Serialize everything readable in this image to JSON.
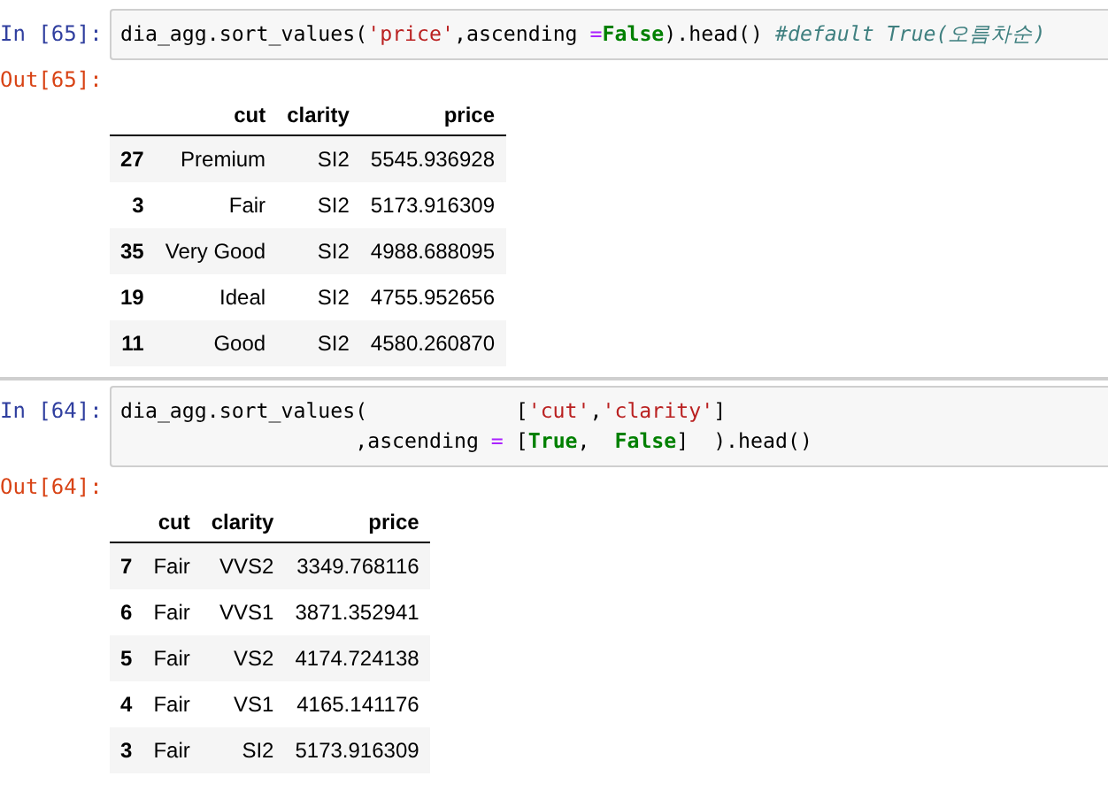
{
  "cells": [
    {
      "in_prompt": "In [65]:",
      "code": [
        [
          {
            "kind": "plain",
            "text": "dia_agg.sort_values("
          },
          {
            "kind": "string",
            "text": "'price'"
          },
          {
            "kind": "plain",
            "text": ",ascending "
          },
          {
            "kind": "operator",
            "text": "="
          },
          {
            "kind": "keyword",
            "text": "False"
          },
          {
            "kind": "plain",
            "text": ").head() "
          },
          {
            "kind": "comment",
            "text": "#default True(오름차순)"
          }
        ]
      ],
      "out_prompt": "Out[65]:",
      "table": {
        "columns": [
          "",
          "cut",
          "clarity",
          "price"
        ],
        "rows": [
          [
            "27",
            "Premium",
            "SI2",
            "5545.936928"
          ],
          [
            "3",
            "Fair",
            "SI2",
            "5173.916309"
          ],
          [
            "35",
            "Very Good",
            "SI2",
            "4988.688095"
          ],
          [
            "19",
            "Ideal",
            "SI2",
            "4755.952656"
          ],
          [
            "11",
            "Good",
            "SI2",
            "4580.260870"
          ]
        ]
      }
    },
    {
      "in_prompt": "In [64]:",
      "code": [
        [
          {
            "kind": "plain",
            "text": "dia_agg.sort_values(            ["
          },
          {
            "kind": "string",
            "text": "'cut'"
          },
          {
            "kind": "plain",
            "text": ","
          },
          {
            "kind": "string",
            "text": "'clarity'"
          },
          {
            "kind": "plain",
            "text": "]"
          }
        ],
        [
          {
            "kind": "plain",
            "text": "                   ,ascending "
          },
          {
            "kind": "operator",
            "text": "="
          },
          {
            "kind": "plain",
            "text": " ["
          },
          {
            "kind": "keyword",
            "text": "True"
          },
          {
            "kind": "plain",
            "text": ",  "
          },
          {
            "kind": "keyword",
            "text": "False"
          },
          {
            "kind": "plain",
            "text": "]  ).head()"
          }
        ]
      ],
      "out_prompt": "Out[64]:",
      "table": {
        "columns": [
          "",
          "cut",
          "clarity",
          "price"
        ],
        "rows": [
          [
            "7",
            "Fair",
            "VVS2",
            "3349.768116"
          ],
          [
            "6",
            "Fair",
            "VVS1",
            "3871.352941"
          ],
          [
            "5",
            "Fair",
            "VS2",
            "4174.724138"
          ],
          [
            "4",
            "Fair",
            "VS1",
            "4165.141176"
          ],
          [
            "3",
            "Fair",
            "SI2",
            "5173.916309"
          ]
        ]
      }
    }
  ]
}
